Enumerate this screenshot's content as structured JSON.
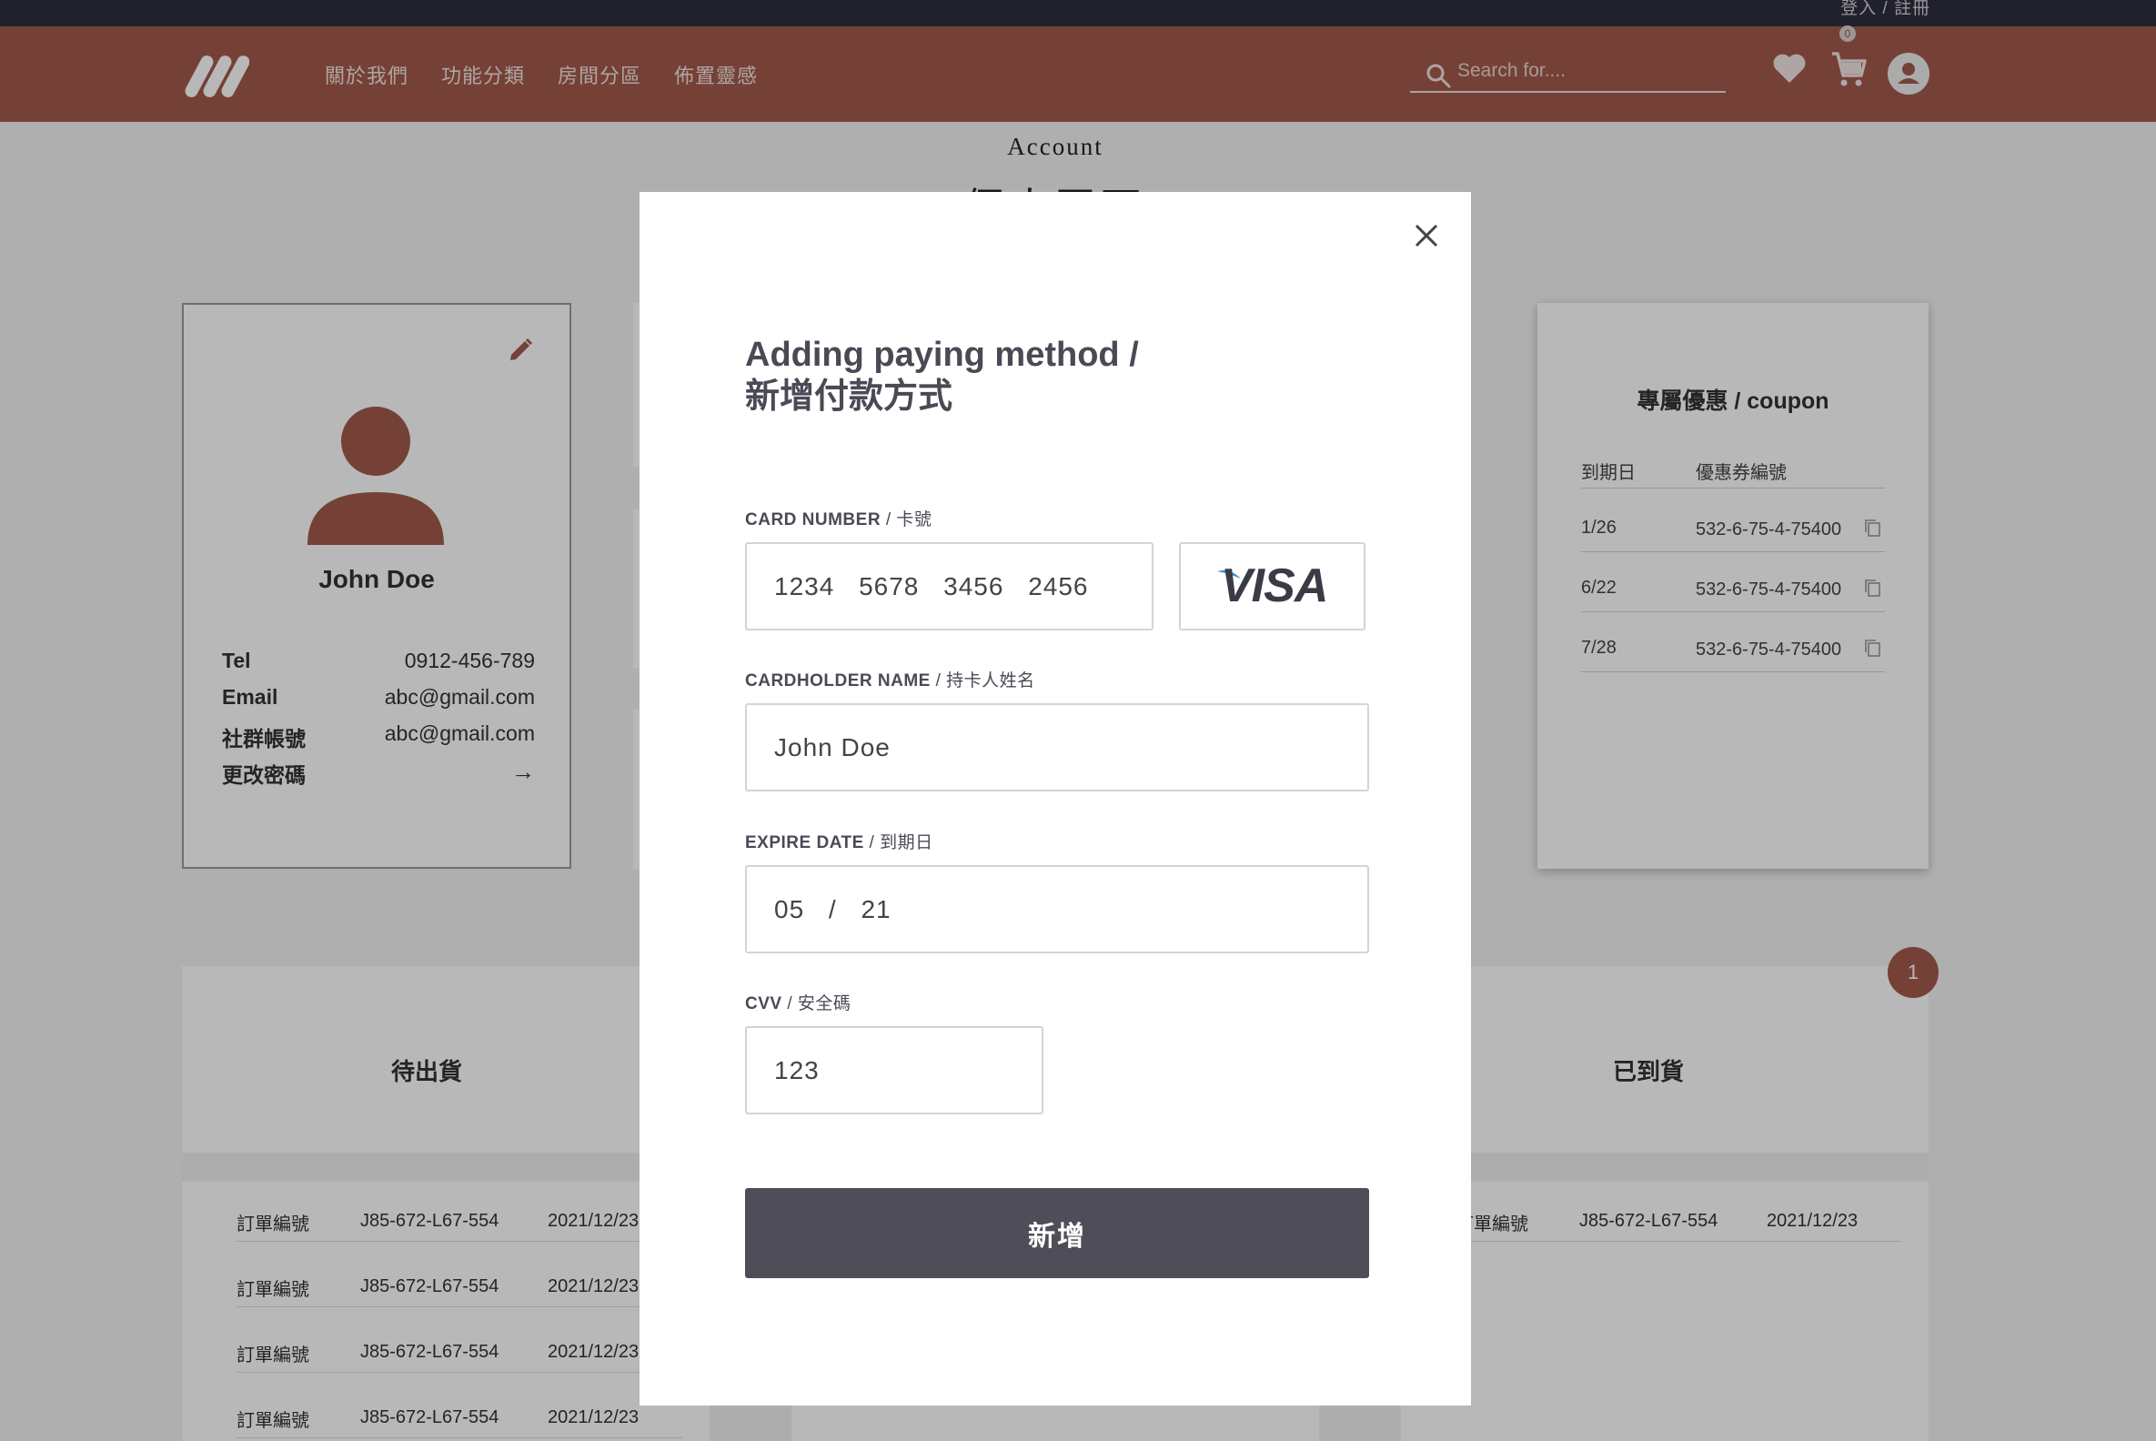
{
  "topbar": {
    "login_label": "登入 / 註冊"
  },
  "header": {
    "nav": [
      "關於我們",
      "功能分類",
      "房間分區",
      "佈置靈感"
    ],
    "search_placeholder": "Search for....",
    "cart_count": "0"
  },
  "page": {
    "subtitle": "Account",
    "title": "個人頁面"
  },
  "profile": {
    "name": "John Doe",
    "rows": [
      {
        "key": "Tel",
        "value": "0912-456-789"
      },
      {
        "key": "Email",
        "value": "abc@gmail.com"
      },
      {
        "key": "社群帳號",
        "value": "abc@gmail.com"
      },
      {
        "key": "更改密碼",
        "value": "→"
      }
    ]
  },
  "coupon": {
    "title": "專屬優惠 / coupon",
    "col_date": "到期日",
    "col_code": "優惠券編號",
    "rows": [
      {
        "date": "1/26",
        "code": "532-6-75-4-75400"
      },
      {
        "date": "6/22",
        "code": "532-6-75-4-75400"
      },
      {
        "date": "7/28",
        "code": "532-6-75-4-75400"
      }
    ]
  },
  "orders": {
    "pending_title": "待出貨",
    "arrived_title": "已到貨",
    "badge_count": "1",
    "pending_rows": [
      {
        "label": "訂單編號",
        "id": "J85-672-L67-554",
        "date": "2021/12/23"
      },
      {
        "label": "訂單編號",
        "id": "J85-672-L67-554",
        "date": "2021/12/23"
      },
      {
        "label": "訂單編號",
        "id": "J85-672-L67-554",
        "date": "2021/12/23"
      },
      {
        "label": "訂單編號",
        "id": "J85-672-L67-554",
        "date": "2021/12/23"
      }
    ],
    "arrived_rows": [
      {
        "label": "訂單編號",
        "id": "J85-672-L67-554",
        "date": "2021/12/23"
      }
    ]
  },
  "modal": {
    "title_en": "Adding paying method /",
    "title_zh": "新增付款方式",
    "card_number_label": "CARD NUMBER",
    "card_number_label_zh": " / 卡號",
    "card_number_value": "1234 5678 3456 2456",
    "card_brand": "VISA",
    "cardholder_label": "CARDHOLDER NAME",
    "cardholder_label_zh": " / 持卡人姓名",
    "cardholder_value": "John Doe",
    "expire_label": "EXPIRE DATE",
    "expire_label_zh": " / 到期日",
    "expire_value": "05 / 21",
    "cvv_label": "CVV",
    "cvv_label_zh": " / 安全碼",
    "cvv_value": "123",
    "submit_label": "新增"
  },
  "colors": {
    "brand": "#a35a4c",
    "dark": "#2f2f3f",
    "button": "#4e4d58"
  }
}
